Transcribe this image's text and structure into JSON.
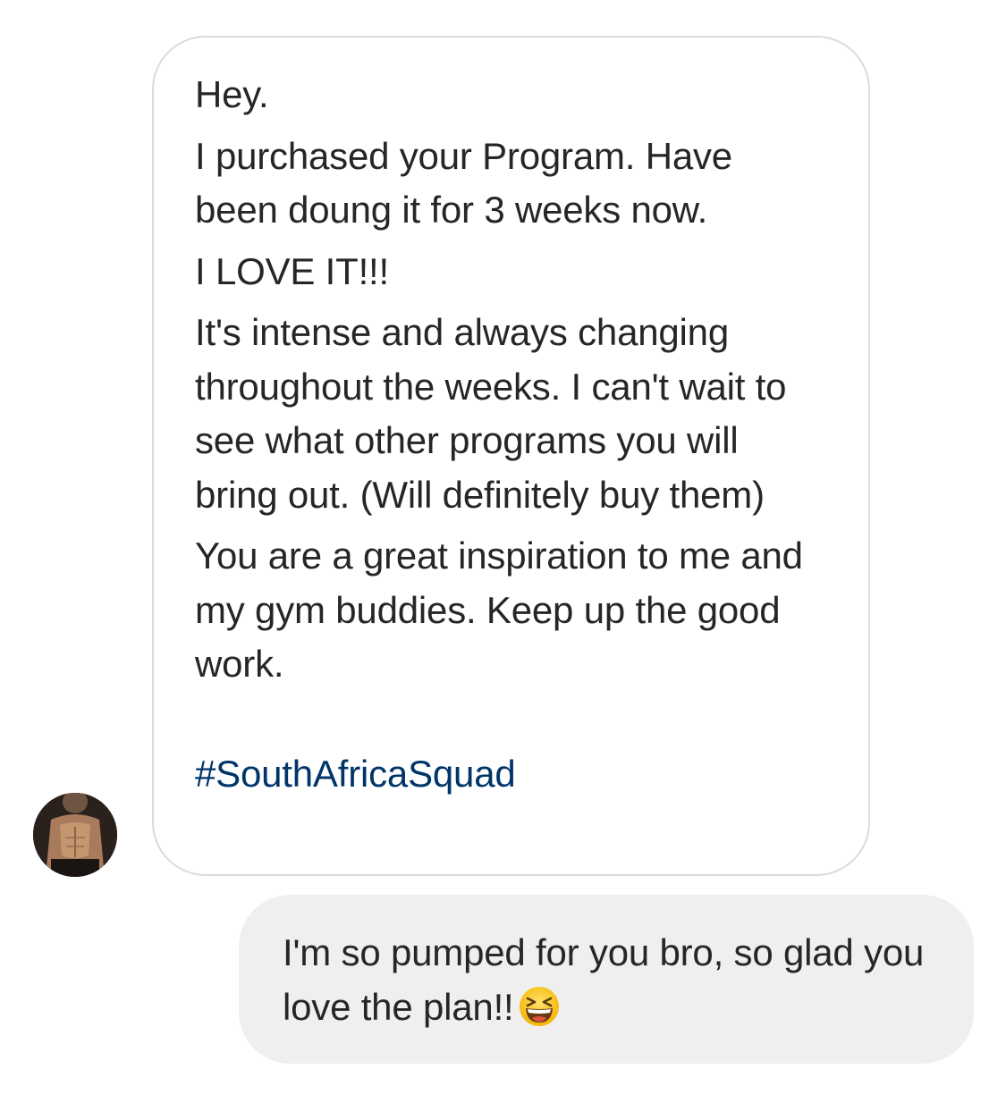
{
  "incoming_message": {
    "paragraphs": [
      "Hey.",
      "I purchased your Program. Have been doung it for 3 weeks now.",
      "I LOVE IT!!!",
      "It's intense and always changing throughout the weeks. I can't wait to see what other programs you will bring out. (Will definitely buy them)",
      "You are a great inspiration to me and my gym buddies. Keep up the good work."
    ],
    "hashtag": "#SouthAfricaSquad"
  },
  "sender_avatar": {
    "icon": "user-avatar-photo"
  },
  "outgoing_message": {
    "text": "I'm so pumped for you bro, so glad you love the plan!!",
    "emoji": "grinning-squinting-face-emoji"
  },
  "colors": {
    "text": "#262626",
    "hashtag": "#003569",
    "incoming_border": "#dbdbdb",
    "outgoing_background": "#efefef"
  }
}
